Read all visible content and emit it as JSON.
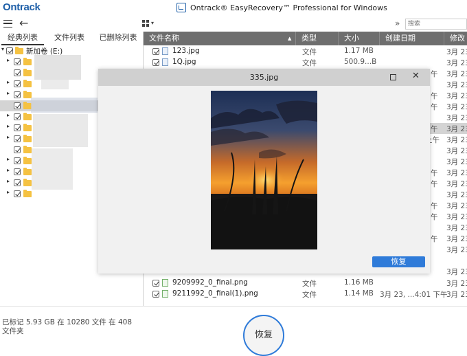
{
  "app": {
    "logo": "Ontrack",
    "title": "Ontrack® EasyRecovery™ Professional for Windows"
  },
  "toolbar": {
    "search_placeholder": "搜索"
  },
  "left_tabs": [
    "经典列表",
    "文件列表",
    "已删除列表"
  ],
  "tree": {
    "root_label": "新加卷 (E:)"
  },
  "columns": [
    "文件名称",
    "类型",
    "大小",
    "创建日期",
    "修改"
  ],
  "files_top": [
    {
      "name": "123.jpg",
      "type": "文件",
      "size": "1.17 MB",
      "created": "",
      "modified": "3月 23,"
    },
    {
      "name": "1Q.jpg",
      "type": "文件",
      "size": "500.9...B",
      "created": "",
      "modified": "3月 23,"
    }
  ],
  "right_side_fragments": [
    {
      "created": "午",
      "modified": "3月 23,"
    },
    {
      "created": "",
      "modified": "3月 23,"
    },
    {
      "created": "午",
      "modified": "3月 23,"
    },
    {
      "created": "午",
      "modified": "3月 23,"
    },
    {
      "created": "",
      "modified": "3月 23,"
    },
    {
      "created": "午",
      "modified": "3月 23,"
    },
    {
      "created": "上午",
      "modified": "3月 23,"
    },
    {
      "created": "",
      "modified": "3月 23,"
    },
    {
      "created": "",
      "modified": "3月 23,"
    },
    {
      "created": "午",
      "modified": "3月 23,"
    },
    {
      "created": "午",
      "modified": "3月 23,"
    },
    {
      "created": "",
      "modified": "3月 23,"
    },
    {
      "created": "午",
      "modified": "3月 23,"
    },
    {
      "created": "午",
      "modified": "3月 23,"
    },
    {
      "created": "",
      "modified": "3月 23,"
    },
    {
      "created": "午",
      "modified": "3月 23,"
    },
    {
      "created": "",
      "modified": "3月 23,"
    },
    {
      "created": "",
      "modified": "3月 23,"
    }
  ],
  "files_bottom": [
    {
      "name": "9209992_0_final.png",
      "type": "文件",
      "size": "1.16 MB",
      "created": "",
      "modified": "3月 23,"
    },
    {
      "name": "9211992_0_final(1).png",
      "type": "文件",
      "size": "1.14 MB",
      "created": "3月 23, ...4:01 下午",
      "modified": "3月 23,"
    }
  ],
  "preview": {
    "title": "335.jpg",
    "restore_label": "恢复"
  },
  "status": {
    "text": "已标记 5.93 GB 在 10280 文件 在 408 文件夹"
  },
  "restore_button": "恢复",
  "colors": {
    "accent": "#2f7bd9",
    "header": "#6e6e6e",
    "brand": "#1e5fa8"
  }
}
